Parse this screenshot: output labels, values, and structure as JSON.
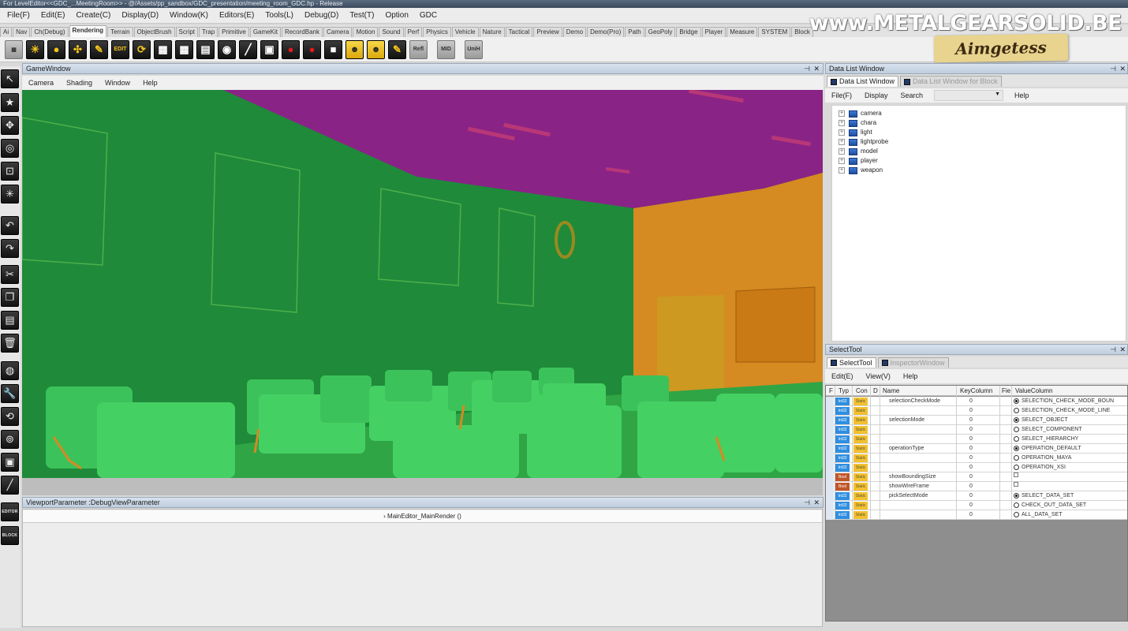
{
  "window_title": "For LevelEditor<<GDC_...MeetingRoom>> - @/Assets/pp_sandbox/GDC_presentation/meeting_room_GDC.hp - Release",
  "menubar": [
    "File(F)",
    "Edit(E)",
    "Create(C)",
    "Display(D)",
    "Window(K)",
    "Editors(E)",
    "Tools(L)",
    "Debug(D)",
    "Test(T)",
    "Option",
    "GDC"
  ],
  "tabs": [
    "Ai",
    "Nav",
    "Ch(Debug)",
    "Rendering",
    "Terrain",
    "ObjectBrush",
    "Script",
    "Trap",
    "Primitive",
    "GameKit",
    "RecordBank",
    "Camera",
    "Motion",
    "Sound",
    "Perf",
    "Physics",
    "Vehicle",
    "Nature",
    "Tactical",
    "Preview",
    "Demo",
    "Demo(Pro)",
    "Path",
    "GeoPoly",
    "Bridge",
    "Player",
    "Measure",
    "SYSTEM",
    "Block"
  ],
  "active_tab": "Rendering",
  "toolbar_labels": {
    "edit": "EDIT",
    "refl": "Refl",
    "mid": "MID",
    "uni": "UniH"
  },
  "side_labels": {
    "editor": "EDITOR",
    "block": "BLOCK"
  },
  "game_window": {
    "title": "GameWindow",
    "menu": [
      "Camera",
      "Shading",
      "Window",
      "Help"
    ]
  },
  "viewport_parameter": {
    "title": "ViewportParameter :DebugViewParameter",
    "row": "MainEditor_MainRender ()"
  },
  "data_list": {
    "title": "Data List Window",
    "tabs": [
      "Data List Window",
      "Data List Window for Block"
    ],
    "menu": [
      "File(F)",
      "Display",
      "Search",
      "Help"
    ],
    "tree": [
      "camera",
      "chara",
      "light",
      "lightprobe",
      "model",
      "player",
      "weapon"
    ]
  },
  "select_tool": {
    "title": "SelectTool",
    "tabs": [
      "SelectTool",
      "InspectorWindow"
    ],
    "menu": [
      "Edit(E)",
      "View(V)",
      "Help"
    ],
    "headers": {
      "f": "F",
      "typ": "Typ",
      "con": "Con",
      "d": "D",
      "name": "Name",
      "key": "KeyColumn",
      "fie": "Fie",
      "value": "ValueColumn"
    },
    "rows": [
      {
        "type": "Int32",
        "con": "Static",
        "name": "selectionCheckMode",
        "key": "0",
        "value": "SELECTION_CHECK_MODE_BOUN",
        "radio": "on"
      },
      {
        "type": "Int32",
        "con": "Static",
        "name": "",
        "key": "0",
        "value": "SELECTION_CHECK_MODE_LINE",
        "radio": "off"
      },
      {
        "type": "Int32",
        "con": "Static",
        "name": "selectionMode",
        "key": "0",
        "value": "SELECT_OBJECT",
        "radio": "on"
      },
      {
        "type": "Int32",
        "con": "Static",
        "name": "",
        "key": "0",
        "value": "SELECT_COMPONENT",
        "radio": "off"
      },
      {
        "type": "Int32",
        "con": "Static",
        "name": "",
        "key": "0",
        "value": "SELECT_HIERARCHY",
        "radio": "off"
      },
      {
        "type": "Int32",
        "con": "Static",
        "name": "operationType",
        "key": "0",
        "value": "OPERATION_DEFAULT",
        "radio": "on"
      },
      {
        "type": "Int32",
        "con": "Static",
        "name": "",
        "key": "0",
        "value": "OPERATION_MAYA",
        "radio": "off"
      },
      {
        "type": "Int32",
        "con": "Static",
        "name": "",
        "key": "0",
        "value": "OPERATION_XSI",
        "radio": "off"
      },
      {
        "type": "Bool",
        "con": "Static",
        "name": "showBoundingSize",
        "key": "0",
        "value": "",
        "radio": "check"
      },
      {
        "type": "Bool",
        "con": "Static",
        "name": "showWireFrame",
        "key": "0",
        "value": "",
        "radio": "check"
      },
      {
        "type": "Int32",
        "con": "Static",
        "name": "pickSelectMode",
        "key": "0",
        "value": "SELECT_DATA_SET",
        "radio": "on"
      },
      {
        "type": "Int32",
        "con": "Static",
        "name": "",
        "key": "0",
        "value": "CHECK_OUT_DATA_SET",
        "radio": "off"
      },
      {
        "type": "Int32",
        "con": "Static",
        "name": "",
        "key": "0",
        "value": "ALL_DATA_SET",
        "radio": "off"
      }
    ]
  },
  "watermark": {
    "site": "www.METALGEARSOLID.BE",
    "badge": "Aimgetess"
  },
  "colors": {
    "wall": "#1f8a3a",
    "ceiling": "#8a2386",
    "side_wall": "#d58a22",
    "chairs": "#3fc15a",
    "int32": "#2f8fe0",
    "bool": "#c0562a",
    "static": "#f2c030"
  }
}
